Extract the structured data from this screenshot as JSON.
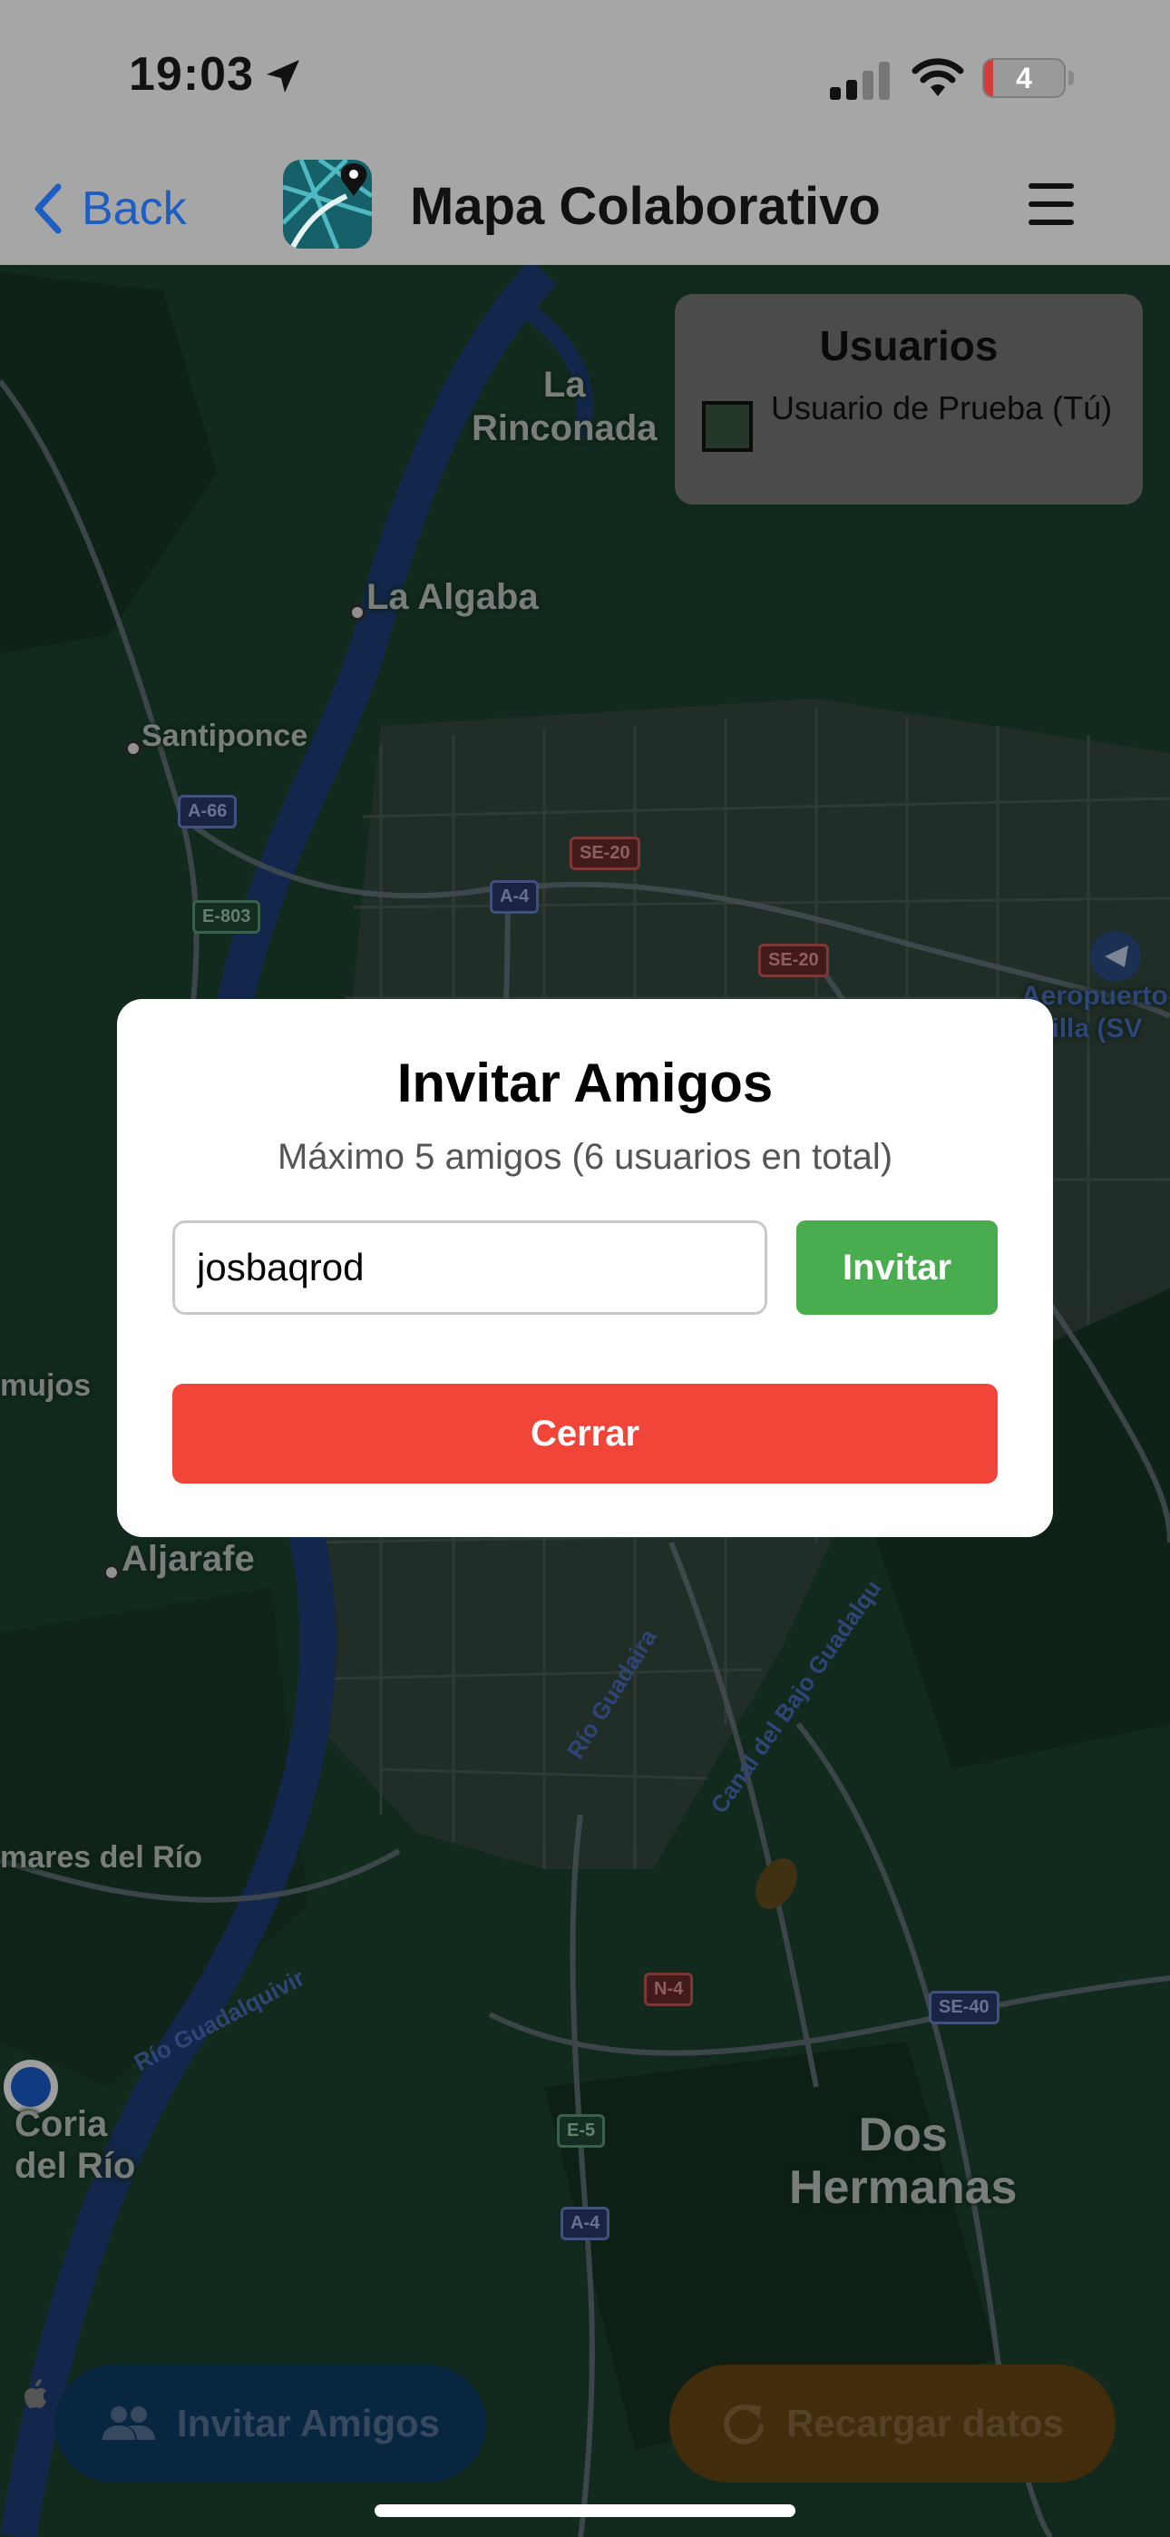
{
  "status_bar": {
    "time": "19:03",
    "battery": "4",
    "icons": [
      "location-arrow-icon",
      "signal-icon",
      "wifi-icon",
      "battery-icon"
    ]
  },
  "nav_bar": {
    "back_label": "Back",
    "title": "Mapa Colaborativo",
    "icons": [
      "chevron-left-icon",
      "app-logo",
      "menu-icon"
    ]
  },
  "users_panel": {
    "title": "Usuarios",
    "users": [
      {
        "name": "Usuario de Prueba (Tú)",
        "color": "#3a5a43"
      }
    ]
  },
  "map": {
    "places": {
      "la_rinconada": "La\nRinconada",
      "la_algaba": "La Algaba",
      "santiponce": "Santiponce",
      "mujos": "mujos",
      "aljarafe": "Aljarafe",
      "mares_del_rio": "mares del Río",
      "coria_del_rio": "Coria\ndel Río",
      "dos_hermanas": "Dos\nHermanas",
      "aeropuerto": "Aeropuerto\nevilla (SV"
    },
    "roads": {
      "a66": "A-66",
      "e803": "E-803",
      "se20_a": "SE-20",
      "se20_b": "SE-20",
      "a4_a": "A-4",
      "a4_b": "A-4",
      "n4": "N-4",
      "se40": "SE-40",
      "e5": "E-5"
    },
    "rivers": {
      "rio_guadaira": "Río Guadaira",
      "canal": "Canal del Bajo Guadalqu",
      "rio_guadalquivir": "Río Guadalquivir"
    }
  },
  "modal": {
    "title": "Invitar Amigos",
    "subtitle": "Máximo 5 amigos (6 usuarios en total)",
    "input_value": "josbaqrod",
    "invite_label": "Invitar",
    "close_label": "Cerrar"
  },
  "bottom_actions": {
    "invite_friends_label": "Invitar Amigos",
    "reload_label": "Recargar datos",
    "icons": [
      "people-icon",
      "refresh-icon"
    ]
  },
  "colors": {
    "accent_blue": "#1d5ec0",
    "invite_green": "#49ad4f",
    "close_red": "#f2453a",
    "map_green": "#1b3d2c"
  }
}
